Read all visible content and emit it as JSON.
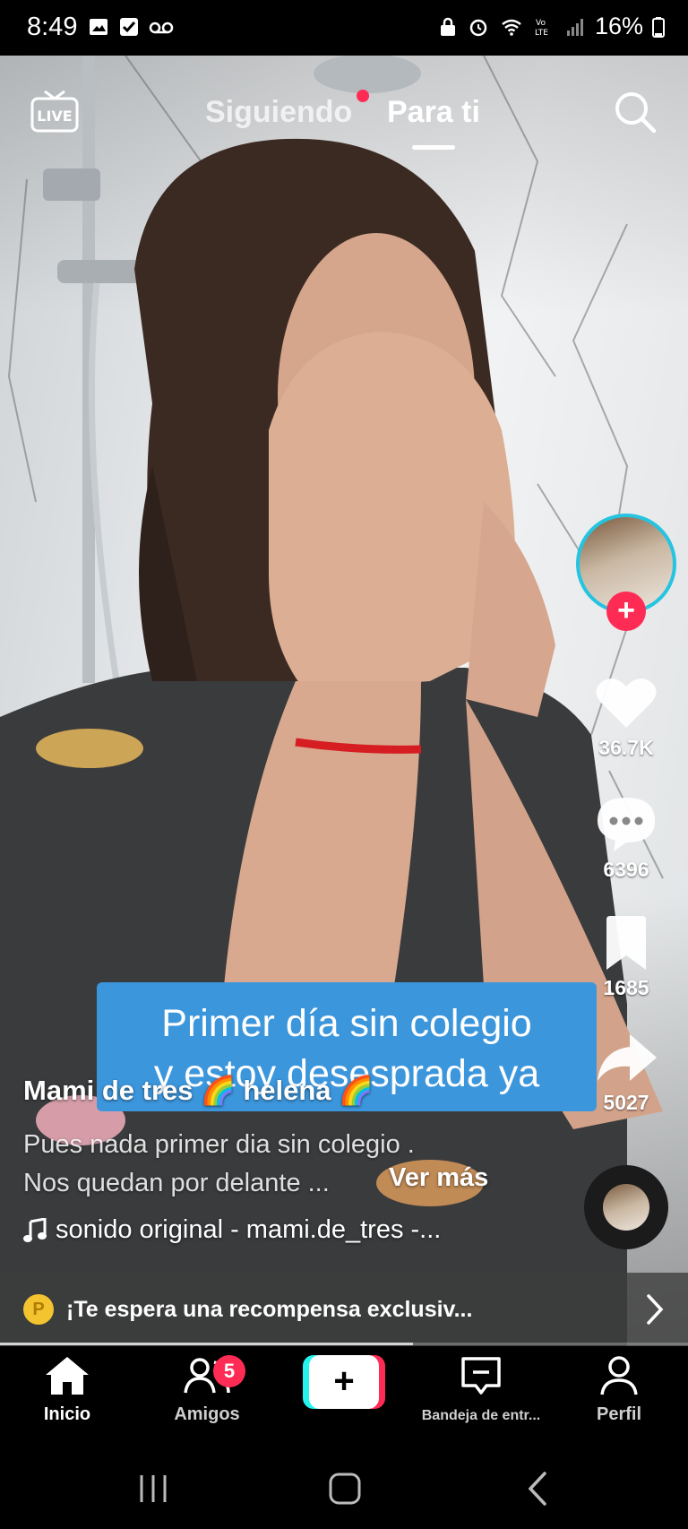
{
  "status_bar": {
    "time": "8:49",
    "battery": "16%",
    "icons_left": [
      "gallery-icon",
      "check-icon",
      "voicemail-icon"
    ],
    "icons_right": [
      "lock-icon",
      "alarm-icon",
      "wifi-icon",
      "volte-icon",
      "signal-icon",
      "battery-icon"
    ]
  },
  "top_nav": {
    "live_label": "LIVE",
    "tab_following": "Siguiendo",
    "tab_foryou": "Para ti"
  },
  "right_rail": {
    "likes": "36.7K",
    "comments": "6396",
    "saves": "1685",
    "shares": "5027"
  },
  "caption": {
    "line1": "Primer día sin colegio",
    "line2": "y estoy desesprada ya"
  },
  "post": {
    "author": "Mami de tres 🌈 helena 🌈",
    "description_line1": "Pues nada primer dia sin colegio .",
    "description_line2": "Nos quedan por delante ...",
    "see_more": "Ver más",
    "sound": "sonido original - mami.de_tres -..."
  },
  "reward": {
    "coin": "P",
    "text": "¡Te espera una recompensa exclusiv..."
  },
  "progress": {
    "fraction": 0.6
  },
  "bottom_nav": {
    "home": "Inicio",
    "friends": "Amigos",
    "friends_badge": "5",
    "create": "+",
    "inbox": "Bandeja de entr...",
    "profile": "Perfil"
  },
  "colors": {
    "accent": "#fe2c55",
    "cyan": "#25f4ee",
    "caption_bg": "#3c96dc",
    "coin": "#f4c430"
  }
}
